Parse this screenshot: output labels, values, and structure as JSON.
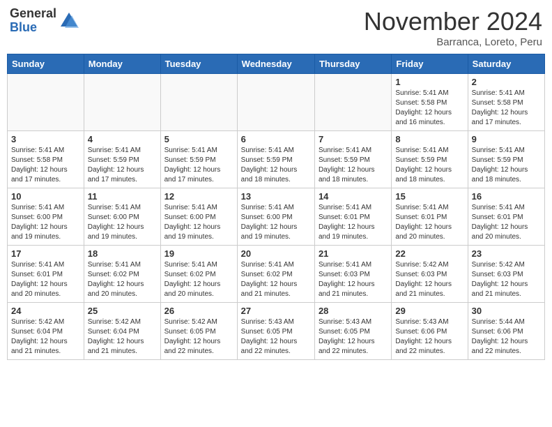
{
  "logo": {
    "general": "General",
    "blue": "Blue"
  },
  "header": {
    "month": "November 2024",
    "location": "Barranca, Loreto, Peru"
  },
  "days_of_week": [
    "Sunday",
    "Monday",
    "Tuesday",
    "Wednesday",
    "Thursday",
    "Friday",
    "Saturday"
  ],
  "weeks": [
    [
      {
        "day": "",
        "info": ""
      },
      {
        "day": "",
        "info": ""
      },
      {
        "day": "",
        "info": ""
      },
      {
        "day": "",
        "info": ""
      },
      {
        "day": "",
        "info": ""
      },
      {
        "day": "1",
        "info": "Sunrise: 5:41 AM\nSunset: 5:58 PM\nDaylight: 12 hours\nand 16 minutes."
      },
      {
        "day": "2",
        "info": "Sunrise: 5:41 AM\nSunset: 5:58 PM\nDaylight: 12 hours\nand 17 minutes."
      }
    ],
    [
      {
        "day": "3",
        "info": "Sunrise: 5:41 AM\nSunset: 5:58 PM\nDaylight: 12 hours\nand 17 minutes."
      },
      {
        "day": "4",
        "info": "Sunrise: 5:41 AM\nSunset: 5:59 PM\nDaylight: 12 hours\nand 17 minutes."
      },
      {
        "day": "5",
        "info": "Sunrise: 5:41 AM\nSunset: 5:59 PM\nDaylight: 12 hours\nand 17 minutes."
      },
      {
        "day": "6",
        "info": "Sunrise: 5:41 AM\nSunset: 5:59 PM\nDaylight: 12 hours\nand 18 minutes."
      },
      {
        "day": "7",
        "info": "Sunrise: 5:41 AM\nSunset: 5:59 PM\nDaylight: 12 hours\nand 18 minutes."
      },
      {
        "day": "8",
        "info": "Sunrise: 5:41 AM\nSunset: 5:59 PM\nDaylight: 12 hours\nand 18 minutes."
      },
      {
        "day": "9",
        "info": "Sunrise: 5:41 AM\nSunset: 5:59 PM\nDaylight: 12 hours\nand 18 minutes."
      }
    ],
    [
      {
        "day": "10",
        "info": "Sunrise: 5:41 AM\nSunset: 6:00 PM\nDaylight: 12 hours\nand 19 minutes."
      },
      {
        "day": "11",
        "info": "Sunrise: 5:41 AM\nSunset: 6:00 PM\nDaylight: 12 hours\nand 19 minutes."
      },
      {
        "day": "12",
        "info": "Sunrise: 5:41 AM\nSunset: 6:00 PM\nDaylight: 12 hours\nand 19 minutes."
      },
      {
        "day": "13",
        "info": "Sunrise: 5:41 AM\nSunset: 6:00 PM\nDaylight: 12 hours\nand 19 minutes."
      },
      {
        "day": "14",
        "info": "Sunrise: 5:41 AM\nSunset: 6:01 PM\nDaylight: 12 hours\nand 19 minutes."
      },
      {
        "day": "15",
        "info": "Sunrise: 5:41 AM\nSunset: 6:01 PM\nDaylight: 12 hours\nand 20 minutes."
      },
      {
        "day": "16",
        "info": "Sunrise: 5:41 AM\nSunset: 6:01 PM\nDaylight: 12 hours\nand 20 minutes."
      }
    ],
    [
      {
        "day": "17",
        "info": "Sunrise: 5:41 AM\nSunset: 6:01 PM\nDaylight: 12 hours\nand 20 minutes."
      },
      {
        "day": "18",
        "info": "Sunrise: 5:41 AM\nSunset: 6:02 PM\nDaylight: 12 hours\nand 20 minutes."
      },
      {
        "day": "19",
        "info": "Sunrise: 5:41 AM\nSunset: 6:02 PM\nDaylight: 12 hours\nand 20 minutes."
      },
      {
        "day": "20",
        "info": "Sunrise: 5:41 AM\nSunset: 6:02 PM\nDaylight: 12 hours\nand 21 minutes."
      },
      {
        "day": "21",
        "info": "Sunrise: 5:41 AM\nSunset: 6:03 PM\nDaylight: 12 hours\nand 21 minutes."
      },
      {
        "day": "22",
        "info": "Sunrise: 5:42 AM\nSunset: 6:03 PM\nDaylight: 12 hours\nand 21 minutes."
      },
      {
        "day": "23",
        "info": "Sunrise: 5:42 AM\nSunset: 6:03 PM\nDaylight: 12 hours\nand 21 minutes."
      }
    ],
    [
      {
        "day": "24",
        "info": "Sunrise: 5:42 AM\nSunset: 6:04 PM\nDaylight: 12 hours\nand 21 minutes."
      },
      {
        "day": "25",
        "info": "Sunrise: 5:42 AM\nSunset: 6:04 PM\nDaylight: 12 hours\nand 21 minutes."
      },
      {
        "day": "26",
        "info": "Sunrise: 5:42 AM\nSunset: 6:05 PM\nDaylight: 12 hours\nand 22 minutes."
      },
      {
        "day": "27",
        "info": "Sunrise: 5:43 AM\nSunset: 6:05 PM\nDaylight: 12 hours\nand 22 minutes."
      },
      {
        "day": "28",
        "info": "Sunrise: 5:43 AM\nSunset: 6:05 PM\nDaylight: 12 hours\nand 22 minutes."
      },
      {
        "day": "29",
        "info": "Sunrise: 5:43 AM\nSunset: 6:06 PM\nDaylight: 12 hours\nand 22 minutes."
      },
      {
        "day": "30",
        "info": "Sunrise: 5:44 AM\nSunset: 6:06 PM\nDaylight: 12 hours\nand 22 minutes."
      }
    ]
  ]
}
